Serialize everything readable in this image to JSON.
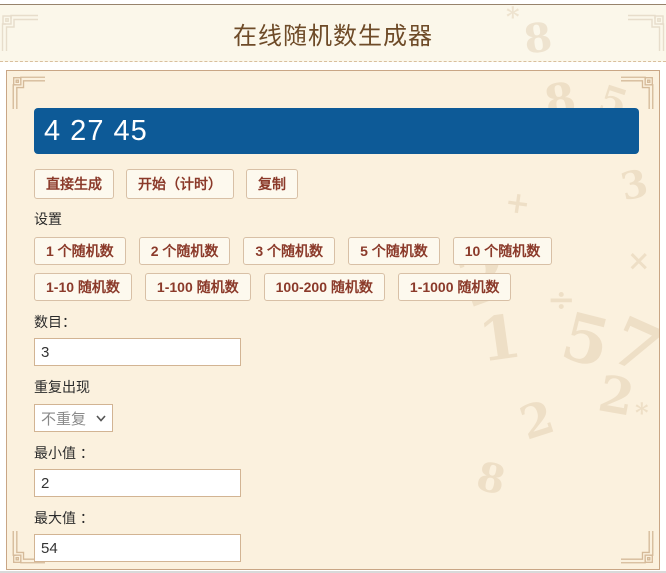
{
  "page": {
    "title": "在线随机数生成器"
  },
  "result": {
    "value": "4 27 45"
  },
  "actions": {
    "generate": "直接生成",
    "start_timer": "开始（计时）",
    "copy": "复制"
  },
  "settings": {
    "label": "设置",
    "count_presets": [
      "1 个随机数",
      "2 个随机数",
      "3 个随机数",
      "5 个随机数",
      "10 个随机数"
    ],
    "range_presets": [
      "1-10 随机数",
      "1-100 随机数",
      "100-200 随机数",
      "1-1000 随机数"
    ]
  },
  "form": {
    "count": {
      "label": "数目：",
      "value": "3"
    },
    "repeat": {
      "label": "重复出现",
      "selected": "不重复"
    },
    "min": {
      "label": "最小值 ：",
      "value": "2"
    },
    "max": {
      "label": "最大值 ：",
      "value": "54"
    }
  },
  "colors": {
    "banner_bg": "#0d5a97",
    "button_text": "#8b3a2a",
    "panel_bg": "#fbf1de",
    "header_bg": "#fbf7ea",
    "accent_border": "#c9a685"
  },
  "watermark": {
    "header_glyphs": [
      "*",
      "8"
    ],
    "panel_glyphs": [
      "5",
      "3",
      "+",
      "2",
      "1",
      "÷",
      "5",
      "7",
      "×",
      "2",
      "2",
      "8",
      "*",
      "8"
    ]
  }
}
